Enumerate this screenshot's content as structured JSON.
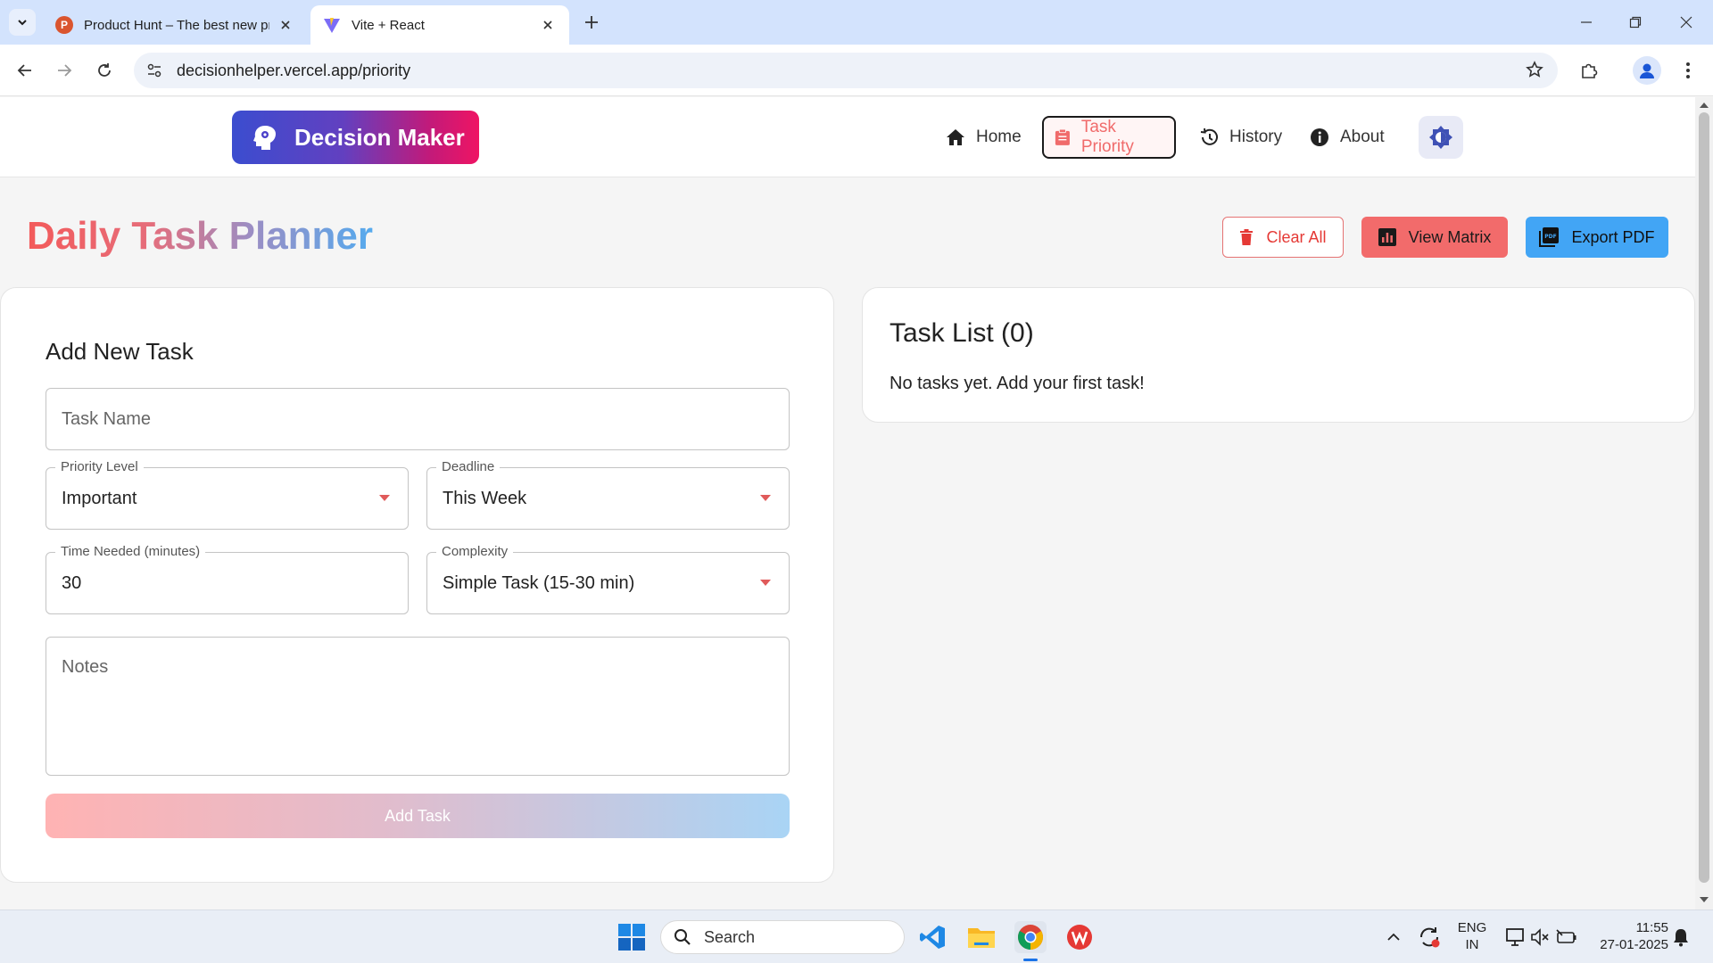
{
  "browser": {
    "tabs": [
      {
        "title": "Product Hunt – The best new pr",
        "active": false
      },
      {
        "title": "Vite + React",
        "active": true
      }
    ],
    "url": "decisionhelper.vercel.app/priority"
  },
  "header": {
    "logo_text": "Decision Maker",
    "nav": [
      {
        "label": "Home",
        "icon": "home-icon"
      },
      {
        "label": "Task Priority",
        "icon": "clipboard-icon",
        "active": true
      },
      {
        "label": "History",
        "icon": "history-icon"
      },
      {
        "label": "About",
        "icon": "info-icon"
      }
    ]
  },
  "page": {
    "title": "Daily Task Planner",
    "actions": {
      "clear": "Clear All",
      "matrix": "View Matrix",
      "export": "Export PDF"
    }
  },
  "form": {
    "heading": "Add New Task",
    "task_name_placeholder": "Task Name",
    "priority_label": "Priority Level",
    "priority_value": "Important",
    "deadline_label": "Deadline",
    "deadline_value": "This Week",
    "time_label": "Time Needed (minutes)",
    "time_value": "30",
    "complexity_label": "Complexity",
    "complexity_value": "Simple Task (15-30 min)",
    "notes_placeholder": "Notes",
    "submit": "Add Task"
  },
  "task_list": {
    "heading": "Task List (0)",
    "empty": "No tasks yet. Add your first task!"
  },
  "taskbar": {
    "search": "Search",
    "lang_line1": "ENG",
    "lang_line2": "IN",
    "time": "11:55",
    "date": "27-01-2025"
  },
  "colors": {
    "accent_red": "#f26b6b",
    "accent_blue": "#42a5f5",
    "logo_gradient_start": "#3b4dcf",
    "logo_gradient_end": "#ef1463"
  }
}
